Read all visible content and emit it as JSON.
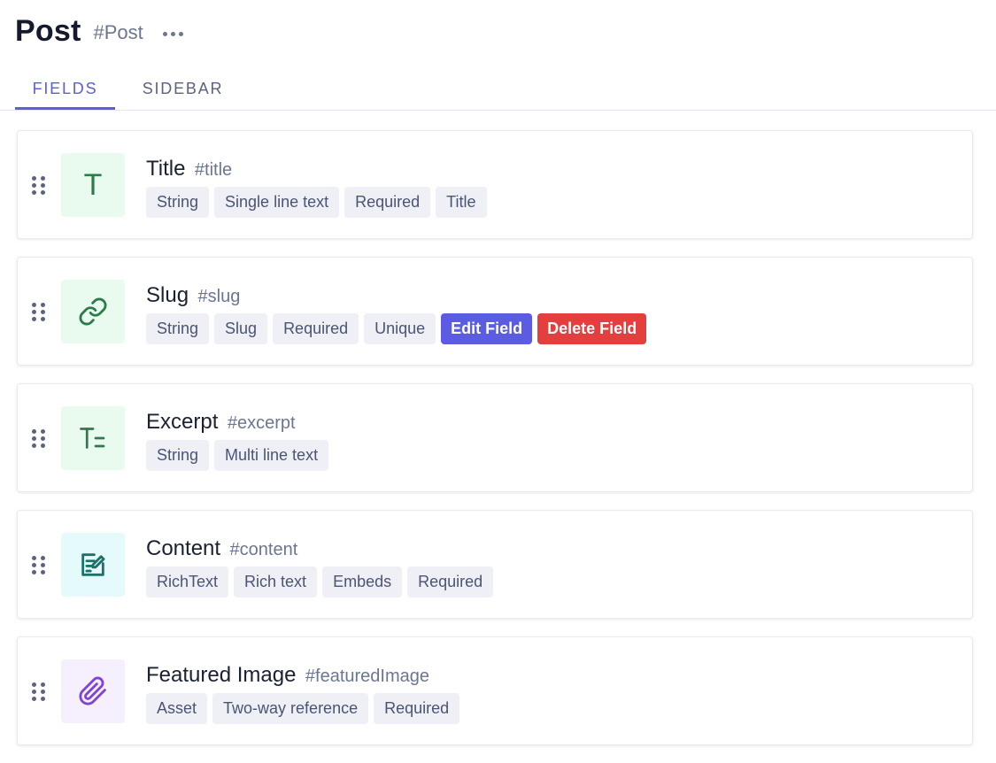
{
  "header": {
    "title": "Post",
    "api_id": "#Post",
    "more_icon": "more-horizontal-icon"
  },
  "tabs": [
    {
      "label": "FIELDS",
      "active": true
    },
    {
      "label": "SIDEBAR",
      "active": false
    }
  ],
  "fields": [
    {
      "name": "Title",
      "api_id": "#title",
      "icon": "text-t-icon",
      "icon_glyph": "T",
      "icon_color": "green",
      "tags": [
        "String",
        "Single line text",
        "Required",
        "Title"
      ]
    },
    {
      "name": "Slug",
      "api_id": "#slug",
      "icon": "link-icon",
      "icon_color": "green",
      "tags": [
        "String",
        "Slug",
        "Required",
        "Unique"
      ],
      "actions": {
        "edit": "Edit Field",
        "delete": "Delete Field"
      }
    },
    {
      "name": "Excerpt",
      "api_id": "#excerpt",
      "icon": "multiline-text-icon",
      "icon_color": "green",
      "tags": [
        "String",
        "Multi line text"
      ]
    },
    {
      "name": "Content",
      "api_id": "#content",
      "icon": "rich-text-edit-icon",
      "icon_color": "teal",
      "tags": [
        "RichText",
        "Rich text",
        "Embeds",
        "Required"
      ]
    },
    {
      "name": "Featured Image",
      "api_id": "#featuredImage",
      "icon": "paperclip-icon",
      "icon_color": "purple",
      "tags": [
        "Asset",
        "Two-way reference",
        "Required"
      ]
    }
  ],
  "colors": {
    "accent": "#5a5fdf",
    "danger": "#e53e3e",
    "tag_bg": "#eef0f6"
  }
}
